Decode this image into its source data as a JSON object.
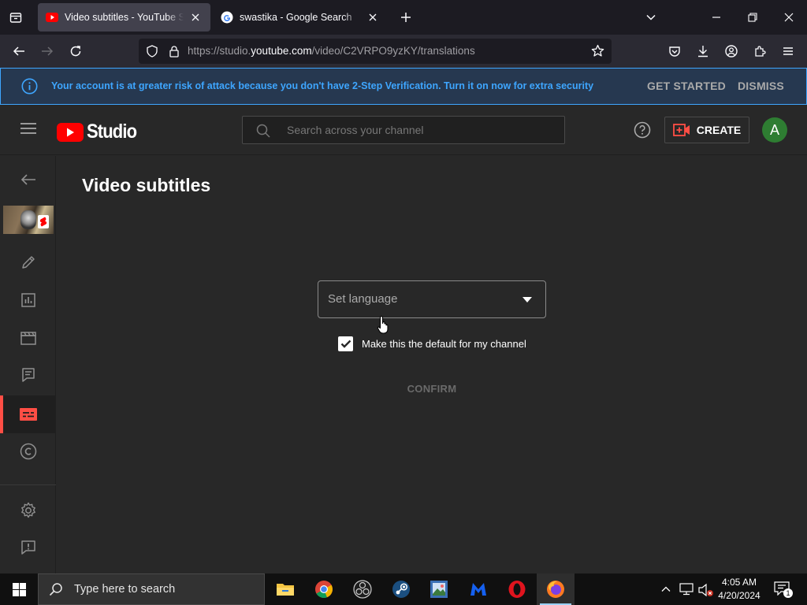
{
  "browser": {
    "tabs": [
      {
        "title": "Video subtitles - YouTube Studio",
        "active": true,
        "favicon": "youtube-studio-icon"
      },
      {
        "title": "swastika - Google Search",
        "active": false,
        "favicon": "google-icon"
      }
    ],
    "url_prefix": "https://studio.",
    "url_domain": "youtube.com",
    "url_path": "/video/C2VRPO9yzKY/translations"
  },
  "banner": {
    "message": "Your account is at greater risk of attack because you don't have 2-Step Verification. Turn it on now for extra security",
    "get_started": "GET STARTED",
    "dismiss": "DISMISS"
  },
  "header": {
    "logo_text": "Studio",
    "search_placeholder": "Search across your channel",
    "create_label": "CREATE",
    "avatar_letter": "A"
  },
  "sidebar": {
    "items": [
      "back-arrow-icon",
      "video-thumbnail",
      "pencil-icon",
      "analytics-icon",
      "editor-clapper-icon",
      "comments-icon",
      "subtitles-icon",
      "copyright-icon",
      "settings-gear-icon",
      "feedback-icon"
    ],
    "active": "subtitles-icon"
  },
  "main": {
    "title": "Video subtitles",
    "language_select": "Set language",
    "default_checkbox_label": "Make this the default for my channel",
    "default_checked": true,
    "confirm_label": "CONFIRM"
  },
  "taskbar": {
    "search_placeholder": "Type here to search",
    "apps": [
      "file-explorer-icon",
      "chrome-icon",
      "obs-icon",
      "steam-icon",
      "image-app-icon",
      "malwarebytes-icon",
      "opera-icon",
      "firefox-icon"
    ],
    "time": "4:05 AM",
    "date": "4/20/2024",
    "notification_count": "1"
  },
  "colors": {
    "accent_blue": "#3ea6ff",
    "studio_red": "#ff0000",
    "active_sidebar": "#ff4e45",
    "background": "#282828"
  }
}
